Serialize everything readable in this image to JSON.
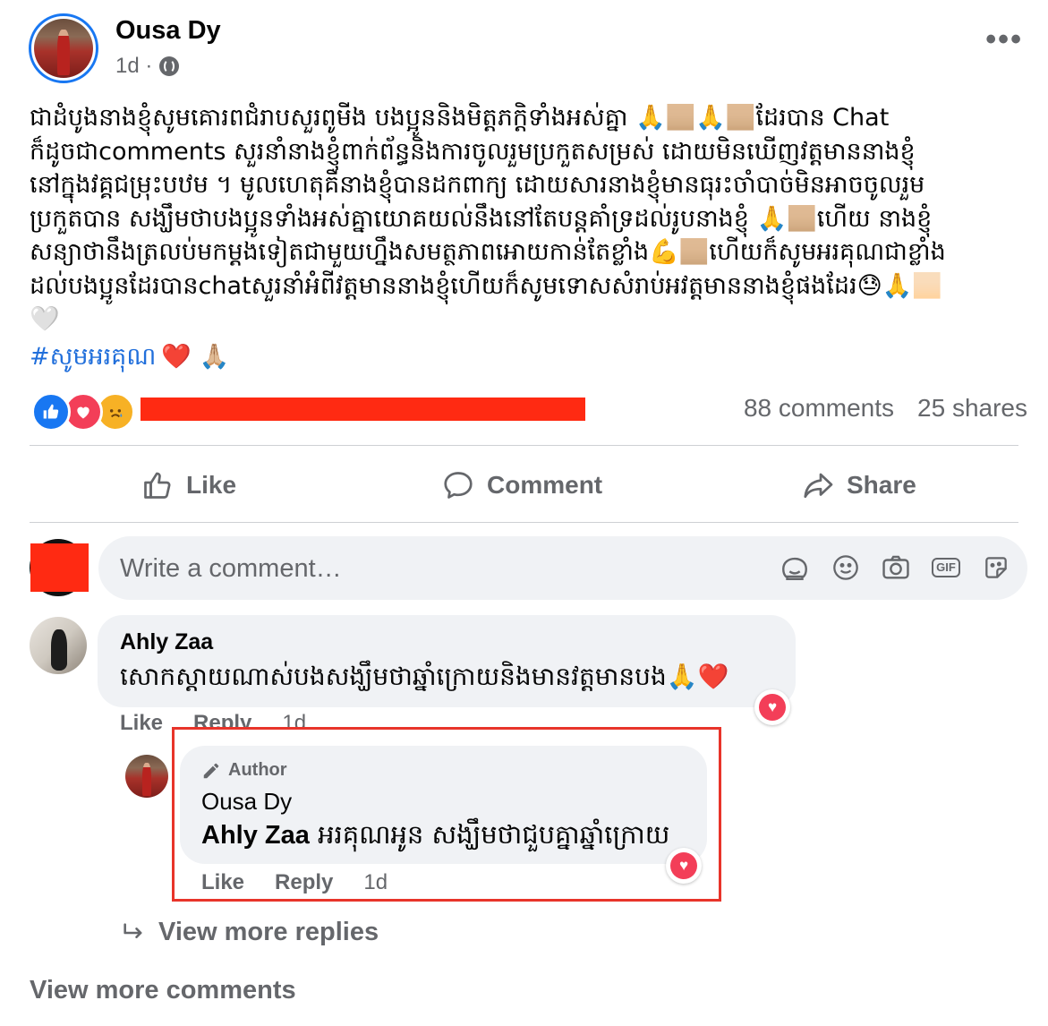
{
  "post": {
    "author": "Ousa Dy",
    "time": "1d ·",
    "text_lines": [
      "ជាដំបូងនាងខ្ញុំសូមគោរពជំរាបសួរពូមីង បងប្អូននិងមិត្តភក្តិទាំងអស់គ្នា 🙏🏼🙏🏼ដែរបាន Chat",
      "ក៏ដូចជាcomments សួរនាំនាងខ្ញុំពាក់ព័ន្ធនិងការចូលរួមប្រកួតសម្រស់ ដោយមិនឃើញវត្តមាននាងខ្ញុំ",
      "នៅក្នុងវគ្គជម្រុះបឋម ។ មូលហេតុគឺនាងខ្ញុំបានដកពាក្យ ដោយសារនាងខ្ញុំមានធុរះចាំបាច់មិនអាចចូលរួម",
      "ប្រកួតបាន សង្ឃឹមថាបងប្អូនទាំងអស់គ្នាយោគយល់នឹងនៅតែបន្តគាំទ្រដល់រូបនាងខ្ញុំ 🙏🏼ហើយ នាងខ្ញុំ",
      "សន្យាថានឹងត្រលប់មកម្តងទៀតជាមួយហ្នឹងសមត្ថភាពអោយកាន់តែខ្លាំង💪🏼ហើយក៏សូមអរគុណជាខ្លាំង",
      "ដល់បងប្អូនដែរបានchatសួរនាំអំពីវត្តមាននាងខ្ញុំហើយក៏សូមទោសសំរាប់អវត្តមាននាងខ្ញុំផងដែរ😓🙏🏻",
      "🤍"
    ],
    "hashtag": "#សូមអរគុណ",
    "hashtag_emoji": "❤️ 🙏🏼",
    "comments_count": "88 comments",
    "shares_count": "25 shares"
  },
  "actions": {
    "like": "Like",
    "comment": "Comment",
    "share": "Share"
  },
  "composer": {
    "placeholder": "Write a comment…"
  },
  "comment1": {
    "name": "Ahly Zaa",
    "text": "សោកស្តាយណាស់បងសង្ឃឹមថាឆ្នាំក្រោយនិងមានវត្តមានបង🙏❤️",
    "like": "Like",
    "reply": "Reply",
    "time": "1d"
  },
  "reply1": {
    "badge": "Author",
    "name": "Ousa Dy",
    "tag": "Ahly Zaa",
    "text": " អរគុណអូន សង្ឃឹមថាជួបគ្នាឆ្នាំក្រោយ",
    "like": "Like",
    "reply": "Reply",
    "time": "1d"
  },
  "view_more_replies": "View more replies",
  "view_more_comments": "View more comments",
  "colors": {
    "brand_blue": "#1877f2",
    "hashtag": "#216fdb",
    "secondary_text": "#65676b",
    "bubble_bg": "#f0f2f5",
    "love": "#f33e58",
    "highlight_red": "#e8342a",
    "redaction": "#ff2a12"
  },
  "icons": [
    "globe-icon",
    "more-icon",
    "like-icon",
    "comment-icon",
    "share-icon",
    "sticker-icon",
    "emoji-icon",
    "camera-icon",
    "gif-icon",
    "sticker2-icon",
    "heart-icon",
    "pencil-icon",
    "reply-arrow-icon"
  ]
}
